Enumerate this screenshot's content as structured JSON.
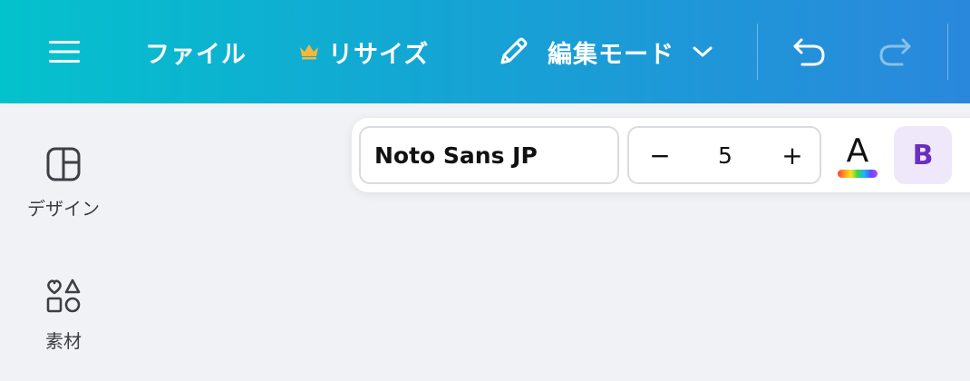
{
  "topbar": {
    "menu_icon": "hamburger-menu-icon",
    "file_label": "ファイル",
    "resize_label": "リサイズ",
    "resize_icon": "crown-icon",
    "resize_icon_color": "#f5b83a",
    "mode_label": "編集モード",
    "mode_icon": "pencil-icon",
    "mode_dropdown_icon": "chevron-down-icon",
    "undo_icon": "undo-icon",
    "redo_icon": "redo-icon"
  },
  "sidebar": {
    "items": [
      {
        "label": "デザイン",
        "icon": "design-layout-icon"
      },
      {
        "label": "素材",
        "icon": "elements-shapes-icon"
      }
    ]
  },
  "text_toolbar": {
    "font_name": "Noto Sans JP",
    "font_size": "5",
    "decrease_label": "−",
    "increase_label": "+",
    "text_color_label": "A",
    "bold_label": "B",
    "bold_active_color": "#6b2fbf"
  }
}
